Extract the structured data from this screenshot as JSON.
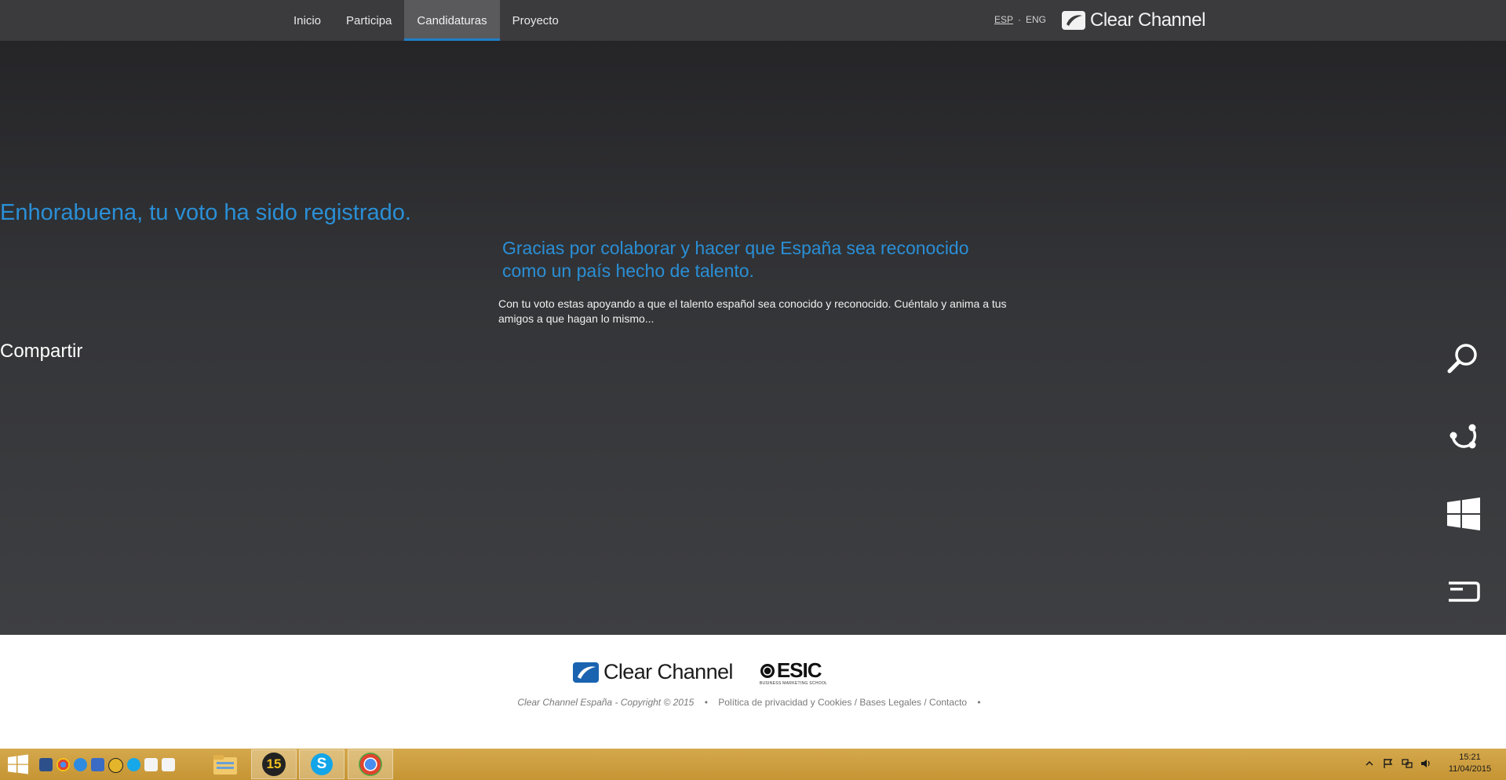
{
  "nav": {
    "items": [
      {
        "label": "Inicio",
        "active": false
      },
      {
        "label": "Participa",
        "active": false
      },
      {
        "label": "Candidaturas",
        "active": true
      },
      {
        "label": "Proyecto",
        "active": false
      }
    ],
    "lang_esp": "ESP",
    "lang_sep": "·",
    "lang_eng": "ENG",
    "brand": "Clear Channel"
  },
  "main": {
    "title": "Enhorabuena, tu voto ha sido registrado.",
    "subtitle": "Gracias por colaborar y hacer que España sea reconocido como un país hecho de talento.",
    "body": "Con tu voto estas apoyando a que el talento español sea conocido y reconocido. Cuéntalo y anima a tus amigos a que hagan lo mismo...",
    "share_label": "Compartir"
  },
  "charms": [
    "search-icon",
    "share-icon",
    "start-icon",
    "devices-icon",
    "settings-icon"
  ],
  "footer": {
    "brand": "Clear Channel",
    "esic": "ESIC",
    "esic_sub": "BUSINESS MARKETING SCHOOL",
    "copyright": "Clear Channel España - Copyright © 2015",
    "bullet": "•",
    "links": "Política de privacidad y Cookies / Bases Legales / Contacto"
  },
  "taskbar": {
    "time": "15:21",
    "date": "11/04/2015",
    "badge_number": "15",
    "colors": {
      "accent": "#c69534",
      "blue": "#2a8fd6"
    }
  }
}
